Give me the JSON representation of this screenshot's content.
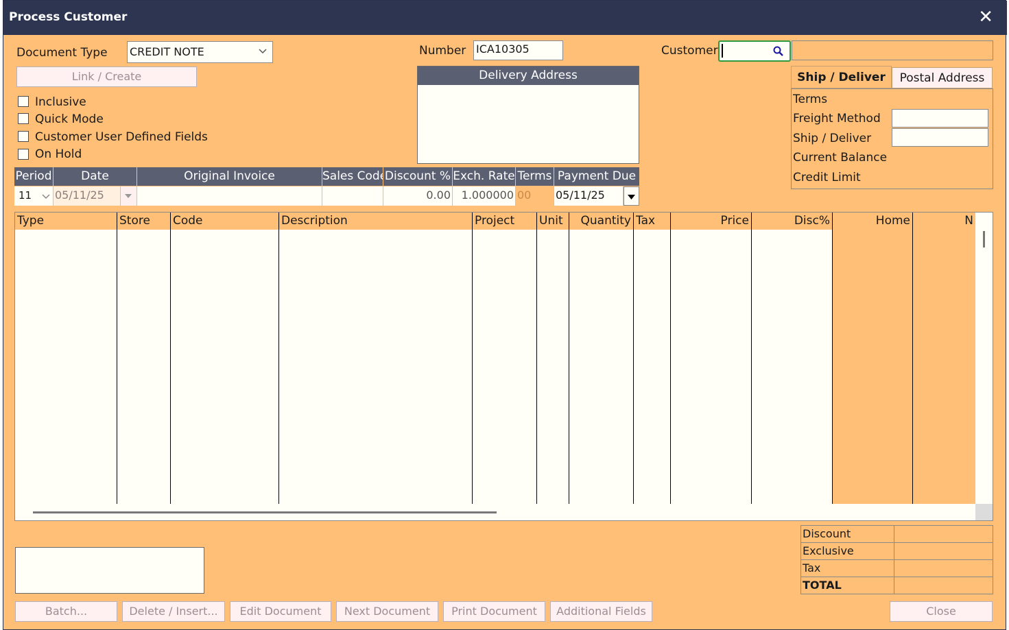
{
  "window": {
    "title": "Process Customer",
    "close_glyph": "✕"
  },
  "header": {
    "document_type_label": "Document Type",
    "document_type_value": "CREDIT NOTE",
    "link_create_label": "Link / Create",
    "number_label": "Number",
    "number_value": "ICA10305",
    "customer_label": "Customer",
    "customer_value": "",
    "customer_name_value": ""
  },
  "checkboxes": [
    {
      "label": "Inclusive",
      "checked": false
    },
    {
      "label": "Quick Mode",
      "checked": false
    },
    {
      "label": "Customer User Defined Fields",
      "checked": false
    },
    {
      "label": "On Hold",
      "checked": false
    }
  ],
  "delivery": {
    "title": "Delivery Address",
    "value": ""
  },
  "address_tabs": {
    "active": "Ship / Deliver",
    "inactive": "Postal Address"
  },
  "customer_info": {
    "terms": "Terms",
    "freight_method": "Freight Method",
    "ship_deliver": "Ship / Deliver",
    "current_balance": "Current Balance",
    "credit_limit": "Credit Limit"
  },
  "doc_row": {
    "headers": [
      "Period",
      "Date",
      "Original Invoice",
      "Sales Code",
      "Discount %",
      "Exch. Rate",
      "Terms",
      "Payment Due"
    ],
    "period": "11",
    "date": "05/11/25",
    "original_invoice": "",
    "sales_code": "",
    "discount": "0.00",
    "exch_rate": "1.000000",
    "terms": "00",
    "payment_due": "05/11/25"
  },
  "grid": {
    "columns": [
      "Type",
      "Store",
      "Code",
      "Description",
      "Project",
      "Unit",
      "Quantity",
      "Tax",
      "Price",
      "Disc%",
      "Home",
      "N"
    ]
  },
  "totals": {
    "discount": "Discount",
    "exclusive": "Exclusive",
    "tax": "Tax",
    "total": "TOTAL"
  },
  "footer_buttons": {
    "batch": "Batch...",
    "delete_insert": "Delete / Insert...",
    "edit_document": "Edit Document",
    "next_document": "Next Document",
    "print_document": "Print Document",
    "additional_fields": "Additional Fields",
    "close": "Close"
  },
  "icons": {
    "search": "search-icon",
    "dropdown": "chevron-down-icon"
  },
  "colors": {
    "body": "#ffbf77",
    "titlebar": "#2d3550",
    "focus": "#2e9a3f"
  }
}
